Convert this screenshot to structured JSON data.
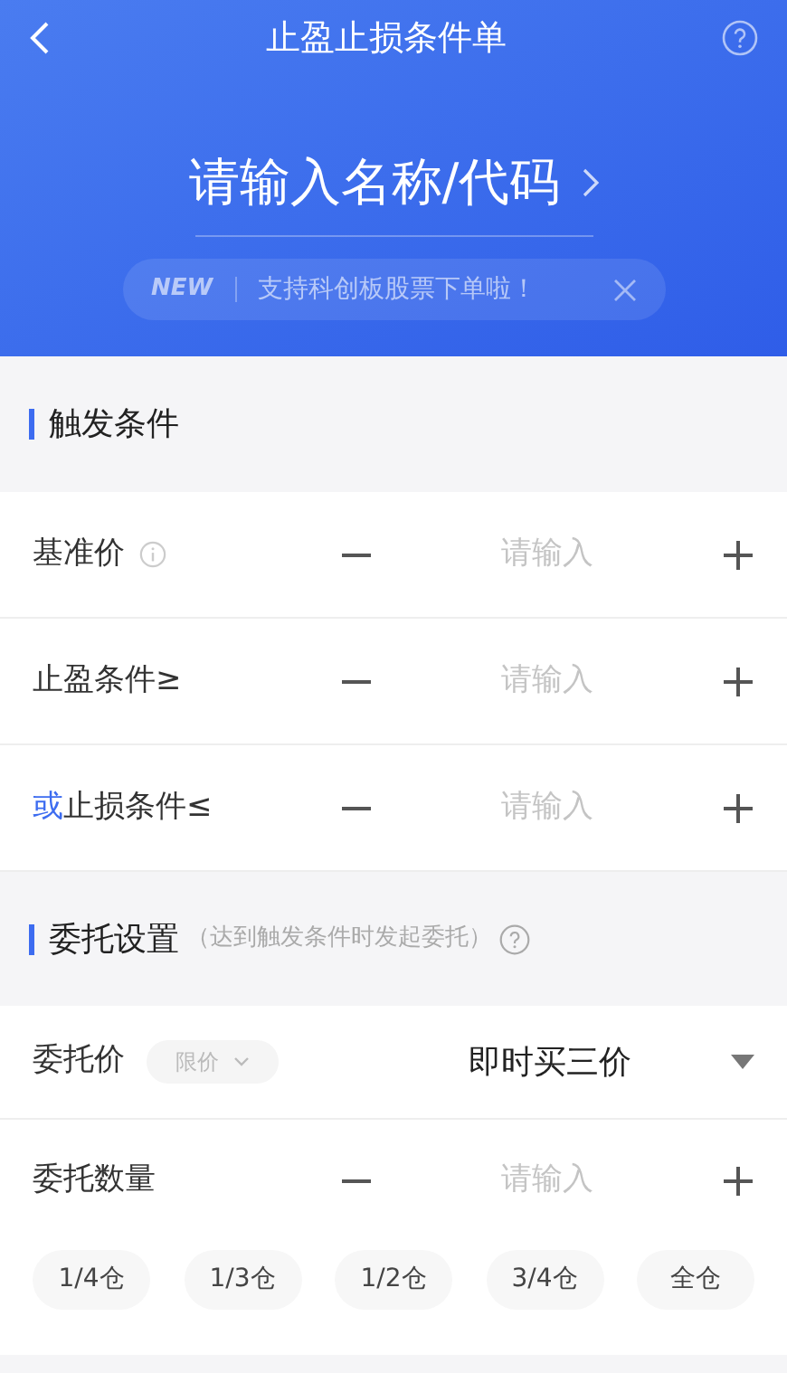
{
  "header": {
    "title": "止盈止损条件单",
    "search_placeholder": "请输入名称/代码",
    "banner": {
      "badge": "NEW",
      "text": "支持科创板股票下单啦！"
    }
  },
  "trigger_section": {
    "title": "触发条件",
    "rows": [
      {
        "label": "基准价",
        "prefix": "",
        "info": true,
        "placeholder": "请输入"
      },
      {
        "label": "止盈条件≥",
        "prefix": "",
        "info": false,
        "placeholder": "请输入"
      },
      {
        "label": "止损条件≤",
        "prefix": "或",
        "info": false,
        "placeholder": "请输入"
      }
    ]
  },
  "order_section": {
    "title": "委托设置",
    "note": "（达到触发条件时发起委托）",
    "price_row": {
      "label": "委托价",
      "type_select": "限价",
      "value": "即时买三价"
    },
    "quantity_row": {
      "label": "委托数量",
      "placeholder": "请输入"
    },
    "quick_amounts": [
      "1/4仓",
      "1/3仓",
      "1/2仓",
      "3/4仓",
      "全仓"
    ]
  }
}
